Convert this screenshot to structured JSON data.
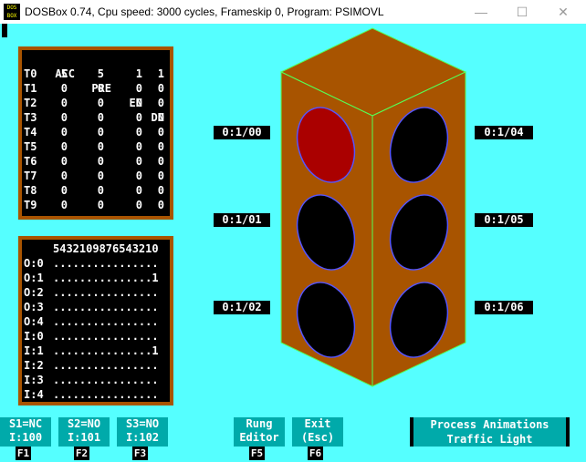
{
  "window": {
    "title": "DOSBox 0.74, Cpu speed:     3000 cycles, Frameskip  0, Program:   PSIMOVL",
    "icon_text": "DOS BOX",
    "minimize_glyph": "—",
    "maximize_glyph": "☐",
    "close_glyph": "✕"
  },
  "timers": {
    "headers": [
      "ACC",
      "PRE",
      "EN",
      "DN"
    ],
    "rows": [
      {
        "name": "T0",
        "acc": "5",
        "pre": "5",
        "en": "1",
        "dn": "1"
      },
      {
        "name": "T1",
        "acc": "0",
        "pre": "0",
        "en": "0",
        "dn": "0"
      },
      {
        "name": "T2",
        "acc": "0",
        "pre": "0",
        "en": "0",
        "dn": "0"
      },
      {
        "name": "T3",
        "acc": "0",
        "pre": "0",
        "en": "0",
        "dn": "0"
      },
      {
        "name": "T4",
        "acc": "0",
        "pre": "0",
        "en": "0",
        "dn": "0"
      },
      {
        "name": "T5",
        "acc": "0",
        "pre": "0",
        "en": "0",
        "dn": "0"
      },
      {
        "name": "T6",
        "acc": "0",
        "pre": "0",
        "en": "0",
        "dn": "0"
      },
      {
        "name": "T7",
        "acc": "0",
        "pre": "0",
        "en": "0",
        "dn": "0"
      },
      {
        "name": "T8",
        "acc": "0",
        "pre": "0",
        "en": "0",
        "dn": "0"
      },
      {
        "name": "T9",
        "acc": "0",
        "pre": "0",
        "en": "0",
        "dn": "0"
      }
    ]
  },
  "io_table": {
    "header": "5432109876543210",
    "rows": [
      {
        "name": "O:0",
        "bits": "................"
      },
      {
        "name": "O:1",
        "bits": "...............1"
      },
      {
        "name": "O:2",
        "bits": "................"
      },
      {
        "name": "O:3",
        "bits": "................"
      },
      {
        "name": "O:4",
        "bits": "................"
      },
      {
        "name": "I:0",
        "bits": "................"
      },
      {
        "name": "I:1",
        "bits": "...............1"
      },
      {
        "name": "I:2",
        "bits": "................"
      },
      {
        "name": "I:3",
        "bits": "................"
      },
      {
        "name": "I:4",
        "bits": "................"
      }
    ]
  },
  "light_labels": {
    "left": [
      "0:1/00",
      "0:1/01",
      "0:1/02"
    ],
    "right": [
      "0:1/04",
      "0:1/05",
      "0:1/06"
    ]
  },
  "lamps": {
    "left": [
      true,
      false,
      false
    ],
    "right": [
      false,
      false,
      false
    ]
  },
  "colors": {
    "background": "#55ffff",
    "housing": "#a85400",
    "edge": "#55ff55",
    "lamp_on": "#aa0000",
    "lamp_off": "#000000",
    "lamp_rim": "#5555ff",
    "button": "#00aaaa"
  },
  "function_keys": [
    {
      "line1": "S1=NC",
      "line2": "I:100",
      "key": "F1"
    },
    {
      "line1": "S2=NO",
      "line2": "I:101",
      "key": "F2"
    },
    {
      "line1": "S3=NO",
      "line2": "I:102",
      "key": "F3"
    },
    {
      "line1": "Rung",
      "line2": "Editor",
      "key": "F5"
    },
    {
      "line1": "Exit",
      "line2": "(Esc)",
      "key": "F6"
    }
  ],
  "status": {
    "line1": "Process Animations",
    "line2": "Traffic Light"
  }
}
